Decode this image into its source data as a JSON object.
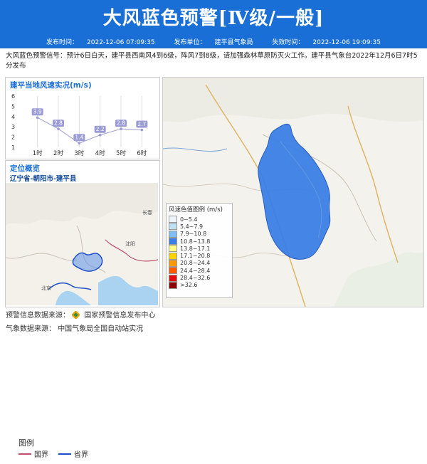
{
  "header": {
    "title": "大风蓝色预警[Ⅳ级/一般]"
  },
  "meta": {
    "publish_label": "发布时间：",
    "publish_time": "2022-12-06 07:09:35",
    "unit_label": "发布单位：",
    "unit": "建平县气象局",
    "expire_label": "失效时间：",
    "expire_time": "2022-12-06 19:09:35"
  },
  "description": "大风蓝色预警信号：预计6日白天，建平县西南风4到6级，阵风7到8级，请加强森林草原防灭火工作。建平县气象台2022年12月6日7时5分发布",
  "wind_panel": {
    "title": "建平当地风速实况(m/s)"
  },
  "chart_data": {
    "type": "line",
    "title": "建平当地风速实况(m/s)",
    "categories": [
      "1时",
      "2时",
      "3时",
      "4时",
      "5时",
      "6时"
    ],
    "values": [
      3.9,
      2.8,
      1.4,
      2.2,
      2.8,
      2.7
    ],
    "y_ticks": [
      1,
      2,
      3,
      4,
      5,
      6
    ],
    "ylim": [
      1,
      6
    ],
    "grid": "vertical",
    "color": "#9b9bd6"
  },
  "location_panel": {
    "title": "定位概览",
    "region": "辽宁省-朝阳市-建平县",
    "legend_title": "图例",
    "legend_items": [
      {
        "label": "国界",
        "color": "#c0506a"
      },
      {
        "label": "省界",
        "color": "#1f4fc7"
      }
    ],
    "map_labels": [
      "北京",
      "沈阳",
      "长春"
    ]
  },
  "wind_legend": {
    "title": "风速色值图例 (m/s)",
    "items": [
      {
        "label": "0~5.4",
        "color": "#eef4fb"
      },
      {
        "label": "5.4~7.9",
        "color": "#bfe0f5"
      },
      {
        "label": "7.9~10.8",
        "color": "#7fbef0"
      },
      {
        "label": "10.8~13.8",
        "color": "#3a7ee6"
      },
      {
        "label": "13.8~17.1",
        "color": "#ffff88"
      },
      {
        "label": "17.1~20.8",
        "color": "#ffd400"
      },
      {
        "label": "20.8~24.4",
        "color": "#ff9a00"
      },
      {
        "label": "24.4~28.4",
        "color": "#ff5a00"
      },
      {
        "label": "28.4~32.6",
        "color": "#e01010"
      },
      {
        "label": ">32.6",
        "color": "#8b0000"
      }
    ]
  },
  "footer": {
    "warning_source_label": "预警信息数据来源：",
    "warning_source": "国家预警信息发布中心",
    "weather_source_label": "气象数据来源：",
    "weather_source": "中国气象局全国自动站实况"
  }
}
